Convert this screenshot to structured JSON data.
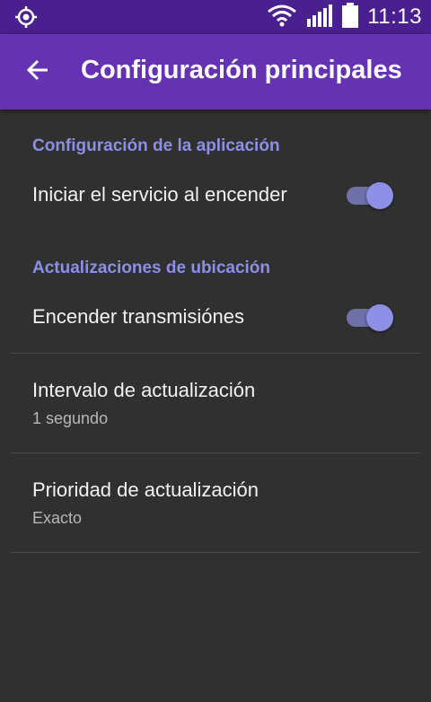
{
  "status_bar": {
    "time": "11:13",
    "left_icon": "gps-target-icon",
    "icons": [
      "wifi-icon",
      "signal-icon",
      "battery-icon"
    ]
  },
  "app_bar": {
    "back_icon": "arrow-back-icon",
    "title": "Configuración principales"
  },
  "sections": [
    {
      "header": "Configuración de la aplicación",
      "items": [
        {
          "title": "Iniciar el servicio al encender",
          "type": "switch",
          "checked": true
        }
      ]
    },
    {
      "header": "Actualizaciones de ubicación",
      "items": [
        {
          "title": "Encender transmisiónes",
          "type": "switch",
          "checked": true
        },
        {
          "title": "Intervalo de actualización",
          "summary": "1 segundo"
        },
        {
          "title": "Prioridad de actualización",
          "summary": "Exacto"
        }
      ]
    }
  ],
  "colors": {
    "status_bar": "#4a1f8f",
    "app_bar": "#6532b3",
    "background": "#303030",
    "accent": "#8c8fe6"
  }
}
